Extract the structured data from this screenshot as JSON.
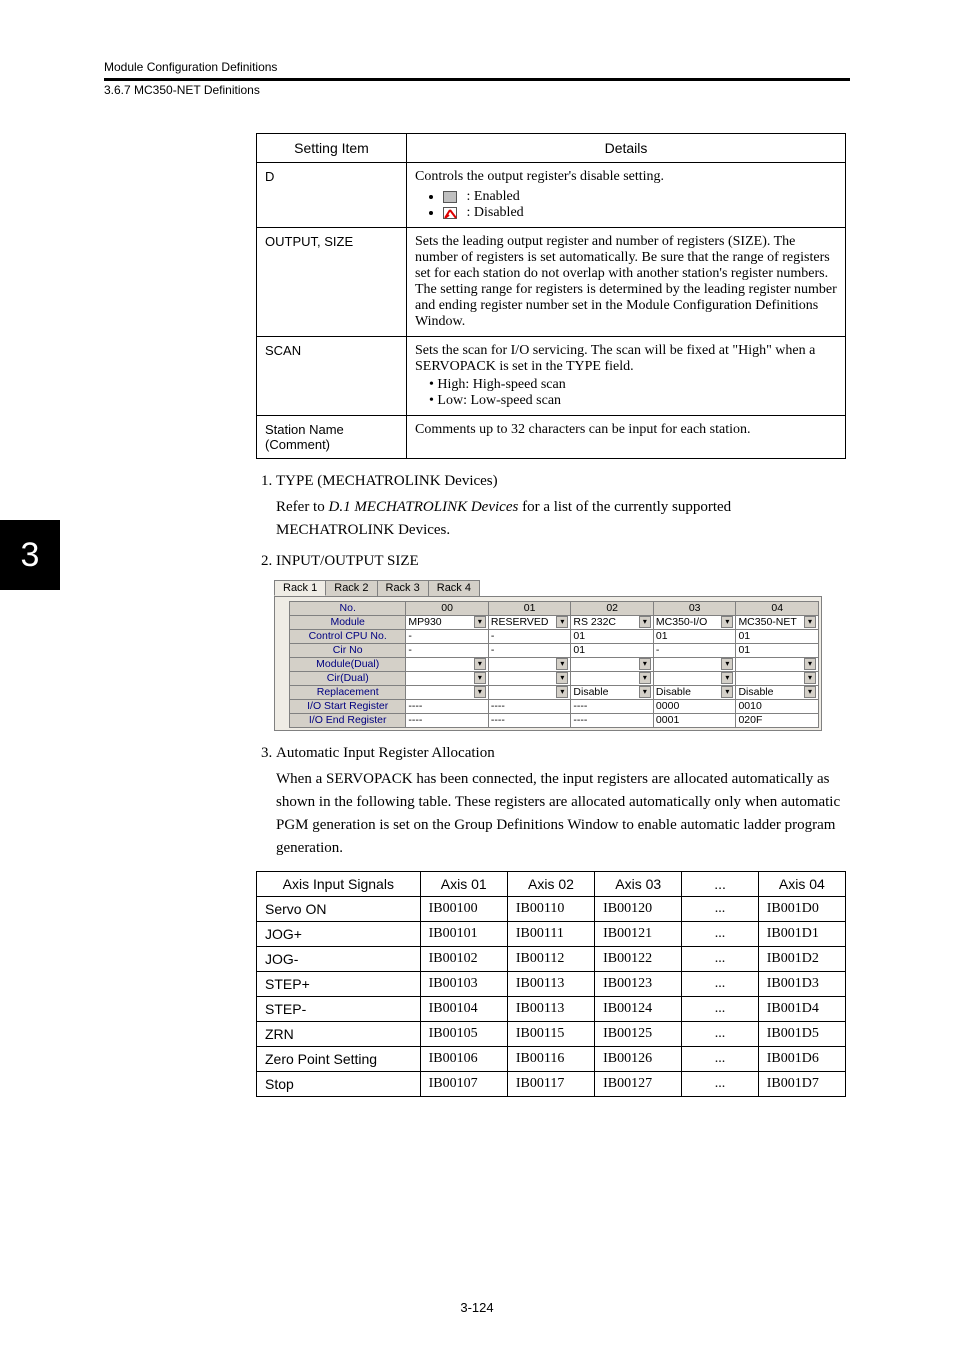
{
  "header": {
    "title": "Module Configuration Definitions",
    "section": "3.6.7  MC350-NET Definitions"
  },
  "side_tab": "3",
  "settings_table": {
    "headers": [
      "Setting Item",
      "Details"
    ],
    "rows": [
      {
        "item": "D",
        "details_intro": "Controls the output register's disable setting.",
        "bullets": [
          {
            "icon": "gray",
            "text": ": Enabled"
          },
          {
            "icon": "red",
            "text": ": Disabled"
          }
        ]
      },
      {
        "item": "OUTPUT, SIZE",
        "details": "Sets the leading output register and number of registers (SIZE). The number of registers is set automatically. Be sure that the range of registers set for each station do not overlap with another station's register numbers. The setting range for registers is determined by the leading register number and ending register number set in the Module Configuration Definitions Window."
      },
      {
        "item": "SCAN",
        "details_intro": "Sets the scan for I/O servicing. The scan will be fixed at \"High\" when a SERVOPACK is set in the TYPE field.",
        "bullets_plain": [
          "• High: High-speed scan",
          "• Low: Low-speed scan"
        ]
      },
      {
        "item": "Station Name (Comment)",
        "details": "Comments up to 32 characters can be input for each station."
      }
    ]
  },
  "list": {
    "items": [
      {
        "title": "TYPE (MECHATROLINK Devices)",
        "body_pre": "Refer to ",
        "body_em": "D.1 MECHATROLINK Devices",
        "body_post": " for a list of the currently supported MECHATROLINK Devices."
      },
      {
        "title": "INPUT/OUTPUT SIZE"
      },
      {
        "title": "Automatic Input Register Allocation",
        "body": "When a SERVOPACK has been connected, the input registers are allocated automatically as shown in the following table. These registers are allocated automatically only when automatic PGM generation is set on the Group Definitions Window to enable automatic ladder program generation."
      }
    ]
  },
  "screenshot": {
    "tabs": [
      "Rack 1",
      "Rack 2",
      "Rack 3",
      "Rack 4"
    ],
    "active_tab": 0,
    "col_headers": [
      "No.",
      "00",
      "01",
      "02",
      "03",
      "04"
    ],
    "row_headers": [
      "Module",
      "Control CPU No.",
      "Cir No",
      "Module(Dual)",
      "Cir(Dual)",
      "Replacement",
      "I/O Start Register",
      "I/O End Register"
    ],
    "rows": [
      [
        "MP930",
        "RESERVED",
        "RS 232C",
        "MC350-I/O",
        "MC350-NET"
      ],
      [
        "-",
        "-",
        "01",
        "01",
        "01"
      ],
      [
        "-",
        "-",
        "01",
        "-",
        "01"
      ],
      [
        "",
        "",
        "",
        "",
        ""
      ],
      [
        "",
        "",
        "",
        "",
        ""
      ],
      [
        "",
        "",
        "Disable",
        "Disable",
        "Disable"
      ],
      [
        "----",
        "----",
        "----",
        "0000",
        "0010"
      ],
      [
        "----",
        "----",
        "----",
        "0001",
        "020F"
      ]
    ],
    "dropdown_rows": [
      true,
      false,
      false,
      true,
      true,
      true,
      false,
      false
    ]
  },
  "axis_table": {
    "headers": [
      "Axis Input Signals",
      "Axis 01",
      "Axis 02",
      "Axis 03",
      "...",
      "Axis 04"
    ],
    "rows": [
      [
        "Servo ON",
        "IB00100",
        "IB00110",
        "IB00120",
        "...",
        "IB001D0"
      ],
      [
        "JOG+",
        "IB00101",
        "IB00111",
        "IB00121",
        "...",
        "IB001D1"
      ],
      [
        "JOG-",
        "IB00102",
        "IB00112",
        "IB00122",
        "...",
        "IB001D2"
      ],
      [
        "STEP+",
        "IB00103",
        "IB00113",
        "IB00123",
        "...",
        "IB001D3"
      ],
      [
        "STEP-",
        "IB00104",
        "IB00113",
        "IB00124",
        "...",
        "IB001D4"
      ],
      [
        "ZRN",
        "IB00105",
        "IB00115",
        "IB00125",
        "...",
        "IB001D5"
      ],
      [
        "Zero Point Setting",
        "IB00106",
        "IB00116",
        "IB00126",
        "...",
        "IB001D6"
      ],
      [
        "Stop",
        "IB00107",
        "IB00117",
        "IB00127",
        "...",
        "IB001D7"
      ]
    ]
  },
  "page_number": "3-124"
}
